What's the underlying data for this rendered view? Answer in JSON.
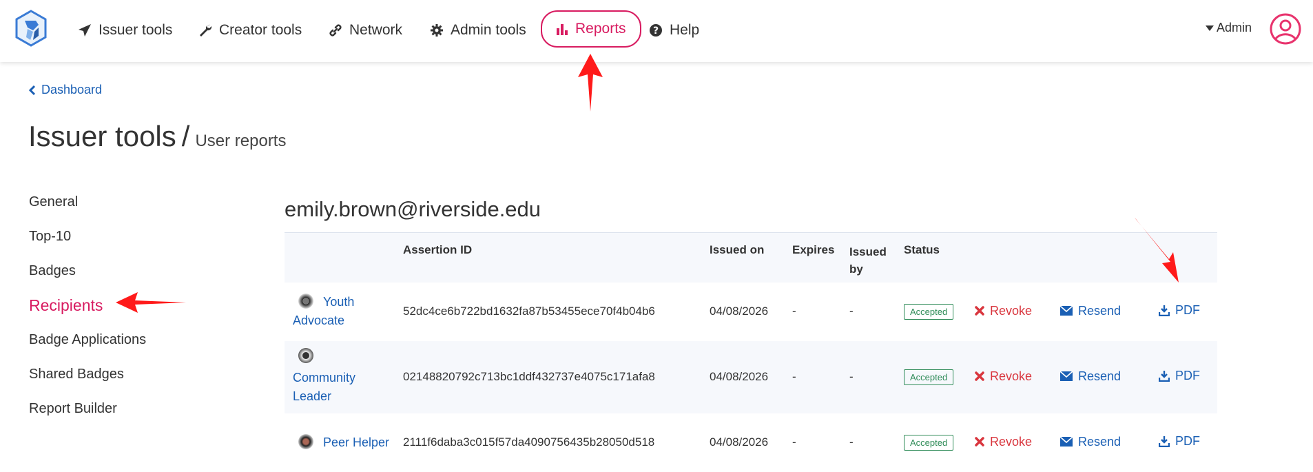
{
  "nav": {
    "items": [
      {
        "label": "Issuer tools",
        "icon": "paper-plane-icon"
      },
      {
        "label": "Creator tools",
        "icon": "wrench-icon"
      },
      {
        "label": "Network",
        "icon": "link-icon"
      },
      {
        "label": "Admin tools",
        "icon": "gear-icon"
      },
      {
        "label": "Reports",
        "icon": "bar-chart-icon"
      },
      {
        "label": "Help",
        "icon": "question-circle-icon"
      }
    ],
    "admin_label": "Admin"
  },
  "breadcrumb": {
    "label": "Dashboard"
  },
  "page": {
    "title": "Issuer tools",
    "separator": "/",
    "subtitle": "User reports"
  },
  "sidebar": {
    "items": [
      {
        "label": "General"
      },
      {
        "label": "Top-10"
      },
      {
        "label": "Badges"
      },
      {
        "label": "Recipients",
        "active": true
      },
      {
        "label": "Badge Applications"
      },
      {
        "label": "Shared Badges"
      },
      {
        "label": "Report Builder"
      }
    ]
  },
  "main": {
    "email": "emily.brown@riverside.edu",
    "columns": [
      "Assertion ID",
      "Issued on",
      "Expires",
      "Issued by",
      "Status"
    ],
    "rows": [
      {
        "badge": "Youth Advocate",
        "assertion_id": "52dc4ce6b722bd1632fa87b53455ece70f4b04b6",
        "issued_on": "04/08/2026",
        "expires": "-",
        "issued_by": "-",
        "status": "Accepted"
      },
      {
        "badge": "Community Leader",
        "assertion_id": "02148820792c713bc1ddf432737e4075c171afa8",
        "issued_on": "04/08/2026",
        "expires": "-",
        "issued_by": "-",
        "status": "Accepted"
      },
      {
        "badge": "Peer Helper",
        "assertion_id": "2111f6daba3c015f57da4090756435b28050d518",
        "issued_on": "04/08/2026",
        "expires": "-",
        "issued_by": "-",
        "status": "Accepted"
      }
    ],
    "actions": {
      "revoke": "Revoke",
      "resend": "Resend",
      "pdf": "PDF"
    }
  },
  "colors": {
    "accent": "#d81b60",
    "link": "#1a5fb4",
    "danger": "#d9363e",
    "success": "#2e8b57",
    "annotation": "#ff1a1a"
  }
}
